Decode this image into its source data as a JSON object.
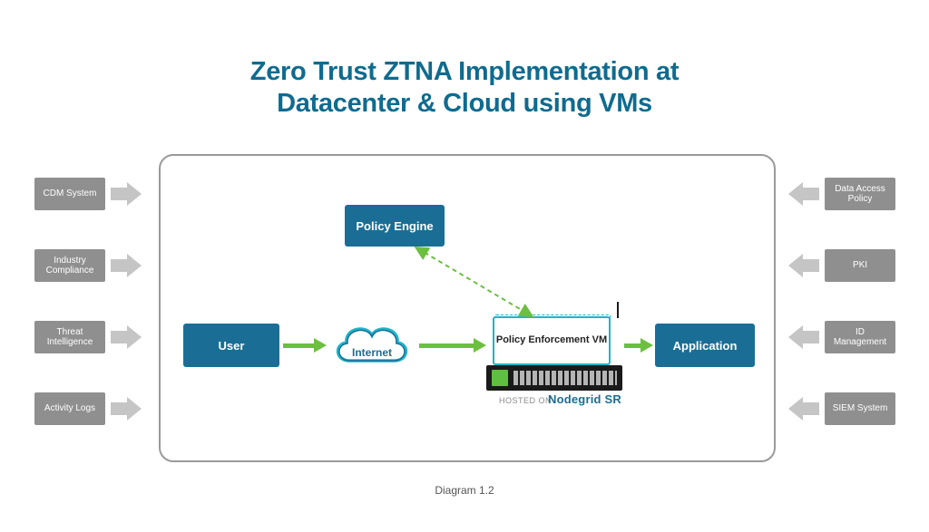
{
  "title_line1": "Zero Trust ZTNA Implementation at",
  "title_line2": "Datacenter & Cloud using VMs",
  "caption": "Diagram 1.2",
  "left_boxes": [
    "CDM System",
    "Industry Compliance",
    "Threat Intelligence",
    "Activity Logs"
  ],
  "right_boxes": [
    "Data Access Policy",
    "PKI",
    "ID Management",
    "SIEM System"
  ],
  "nodes": {
    "user": "User",
    "internet": "Internet",
    "policy_engine": "Policy Engine",
    "policy_enforcement": "Policy Enforcement VM",
    "application": "Application"
  },
  "hosted_on_label": "HOSTED ON",
  "nodegrid_label": "Nodegrid SR",
  "colors": {
    "title": "#0f6b8f",
    "node_blue": "#1a6e95",
    "accent_teal": "#1fb4c9",
    "arrow_green": "#6cbf3f",
    "side_gray": "#8f8f8f",
    "side_arrow_gray": "#c5c5c5"
  }
}
